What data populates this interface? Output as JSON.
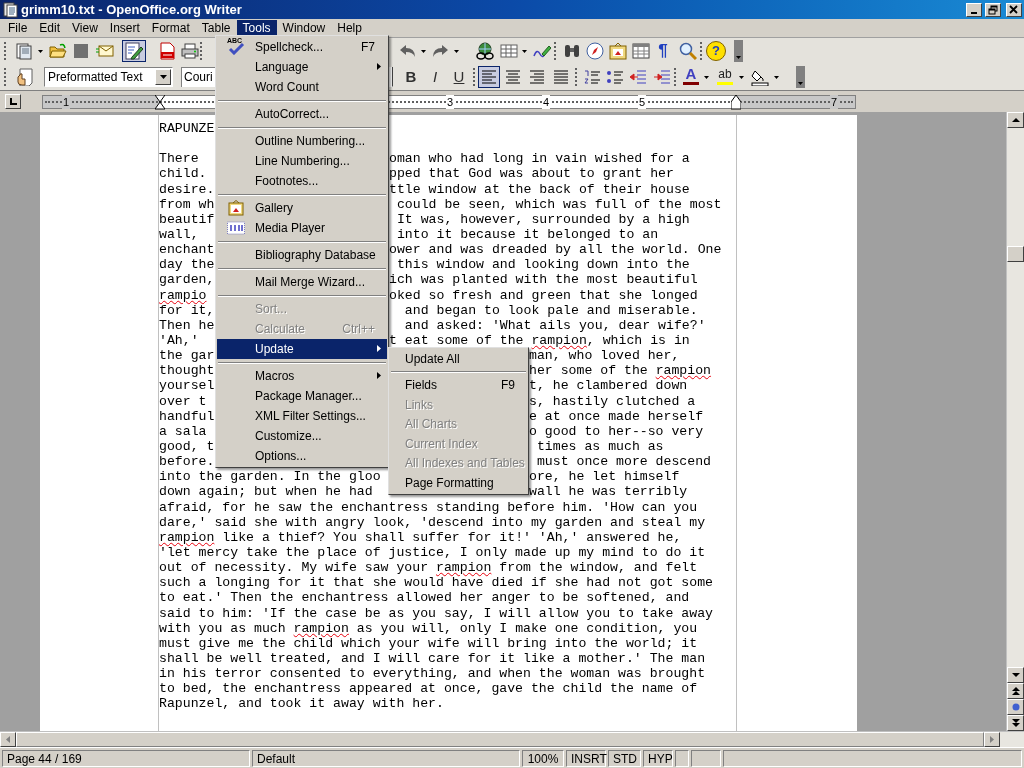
{
  "window": {
    "title": "grimm10.txt - OpenOffice.org Writer"
  },
  "menubar": [
    {
      "label": "File",
      "selected": false
    },
    {
      "label": "Edit",
      "selected": false
    },
    {
      "label": "View",
      "selected": false
    },
    {
      "label": "Insert",
      "selected": false
    },
    {
      "label": "Format",
      "selected": false
    },
    {
      "label": "Table",
      "selected": false
    },
    {
      "label": "Tools",
      "selected": true
    },
    {
      "label": "Window",
      "selected": false
    },
    {
      "label": "Help",
      "selected": false
    }
  ],
  "standard_toolbar": {
    "edit_mode_on": true,
    "pilcrow_glyph": "¶",
    "help_glyph": "?"
  },
  "formatting_toolbar": {
    "paragraph_style": "Preformatted Text",
    "font_name": "Couri",
    "format_buttons": [
      {
        "label": "B",
        "on": false
      },
      {
        "label": "I",
        "on": false
      },
      {
        "label": "U",
        "on": false
      }
    ],
    "alignment": [
      {
        "selected": true
      },
      {
        "selected": false
      },
      {
        "selected": false
      },
      {
        "selected": false
      }
    ],
    "font_color_glyph": "A",
    "highlight_glyph": "ab"
  },
  "ruler": {
    "labels": [
      "1",
      "3",
      "4",
      "5",
      "7"
    ]
  },
  "document": {
    "paragraphs": [
      {
        "lines": [
          {
            "segments": [
              {
                "kind": "left",
                "runs": [
                  {
                    "text": "RAPUNZE",
                    "misspelled": false
                  }
                ]
              }
            ]
          }
        ]
      },
      {
        "lines": [
          {
            "segments": [
              {
                "kind": "left",
                "runs": [
                  {
                    "text": "There ",
                    "misspelled": false
                  }
                ]
              },
              {
                "kind": "after_menu",
                "runs": [
                  {
                    "text": "oman who had long in vain wished for a",
                    "misspelled": false
                  }
                ]
              }
            ]
          },
          {
            "segments": [
              {
                "kind": "left",
                "runs": [
                  {
                    "text": "child.",
                    "misspelled": false
                  }
                ]
              },
              {
                "kind": "after_menu",
                "runs": [
                  {
                    "text": "pped that God was about to grant her",
                    "misspelled": false
                  }
                ]
              }
            ]
          },
          {
            "segments": [
              {
                "kind": "left",
                "runs": [
                  {
                    "text": "desire.",
                    "misspelled": false
                  }
                ]
              },
              {
                "kind": "after_menu",
                "runs": [
                  {
                    "text": "ttle window at the back of their house",
                    "misspelled": false
                  }
                ]
              }
            ]
          },
          {
            "segments": [
              {
                "kind": "left",
                "runs": [
                  {
                    "text": "from wh",
                    "misspelled": false
                  }
                ]
              },
              {
                "kind": "after_menu",
                "runs": [
                  {
                    "text": " could be seen, which was full of the most",
                    "misspelled": false
                  }
                ]
              }
            ]
          },
          {
            "segments": [
              {
                "kind": "left",
                "runs": [
                  {
                    "text": "beautif",
                    "misspelled": false
                  }
                ]
              },
              {
                "kind": "after_menu",
                "runs": [
                  {
                    "text": " It was, however, surrounded by a high",
                    "misspelled": false
                  }
                ]
              }
            ]
          },
          {
            "segments": [
              {
                "kind": "left",
                "runs": [
                  {
                    "text": "wall, ",
                    "misspelled": false
                  }
                ]
              },
              {
                "kind": "after_menu",
                "runs": [
                  {
                    "text": " into it because it belonged to an",
                    "misspelled": false
                  }
                ]
              }
            ]
          },
          {
            "segments": [
              {
                "kind": "left",
                "runs": [
                  {
                    "text": "enchant",
                    "misspelled": false
                  }
                ]
              },
              {
                "kind": "after_menu",
                "runs": [
                  {
                    "text": "ower and was dreaded by all the world. One",
                    "misspelled": false
                  }
                ]
              }
            ]
          },
          {
            "segments": [
              {
                "kind": "left",
                "runs": [
                  {
                    "text": "day the",
                    "misspelled": false
                  }
                ]
              },
              {
                "kind": "after_menu",
                "runs": [
                  {
                    "text": " this window and looking down into the",
                    "misspelled": false
                  }
                ]
              }
            ]
          },
          {
            "segments": [
              {
                "kind": "left",
                "runs": [
                  {
                    "text": "garden,",
                    "misspelled": false
                  }
                ]
              },
              {
                "kind": "after_menu",
                "runs": [
                  {
                    "text": "ich was planted with the most beautiful",
                    "misspelled": false
                  }
                ]
              }
            ]
          },
          {
            "segments": [
              {
                "kind": "left",
                "runs": [
                  {
                    "text": "rampio",
                    "misspelled": true
                  }
                ]
              },
              {
                "kind": "after_menu",
                "runs": [
                  {
                    "text": "oked so fresh and green that she longed",
                    "misspelled": false
                  }
                ]
              }
            ]
          },
          {
            "segments": [
              {
                "kind": "left",
                "runs": [
                  {
                    "text": "for it,",
                    "misspelled": false
                  }
                ]
              },
              {
                "kind": "after_menu",
                "runs": [
                  {
                    "text": "  and began to look pale and miserable.",
                    "misspelled": false
                  }
                ]
              }
            ]
          },
          {
            "segments": [
              {
                "kind": "left",
                "runs": [
                  {
                    "text": "Then he",
                    "misspelled": false
                  }
                ]
              },
              {
                "kind": "after_menu",
                "runs": [
                  {
                    "text": "  and asked: 'What ails you, dear wife?'",
                    "misspelled": false
                  }
                ]
              }
            ]
          },
          {
            "segments": [
              {
                "kind": "left",
                "runs": [
                  {
                    "text": "'Ah,' ",
                    "misspelled": false
                  }
                ]
              },
              {
                "kind": "after_menu",
                "runs": [
                  {
                    "text": "t eat some of the ",
                    "misspelled": false
                  },
                  {
                    "text": "rampion",
                    "misspelled": true
                  },
                  {
                    "text": ", which is in",
                    "misspelled": false
                  }
                ]
              }
            ]
          },
          {
            "segments": [
              {
                "kind": "left",
                "runs": [
                  {
                    "text": "the gar",
                    "misspelled": false
                  }
                ]
              },
              {
                "kind": "after_submenu",
                "runs": [
                  {
                    "text": "man, who loved her,",
                    "misspelled": false
                  }
                ]
              }
            ]
          },
          {
            "segments": [
              {
                "kind": "left",
                "runs": [
                  {
                    "text": "thought",
                    "misspelled": false
                  }
                ]
              },
              {
                "kind": "after_submenu",
                "runs": [
                  {
                    "text": "her some of the ",
                    "misspelled": false
                  },
                  {
                    "text": "rampion",
                    "misspelled": true
                  }
                ]
              }
            ]
          },
          {
            "segments": [
              {
                "kind": "left",
                "runs": [
                  {
                    "text": "yoursel",
                    "misspelled": false
                  }
                ]
              },
              {
                "kind": "after_submenu",
                "runs": [
                  {
                    "text": "t, he clambered down",
                    "misspelled": false
                  }
                ]
              }
            ]
          },
          {
            "segments": [
              {
                "kind": "left",
                "runs": [
                  {
                    "text": "over t",
                    "misspelled": false
                  }
                ]
              },
              {
                "kind": "after_submenu",
                "runs": [
                  {
                    "text": "s, hastily clutched a",
                    "misspelled": false
                  }
                ]
              }
            ]
          },
          {
            "segments": [
              {
                "kind": "left",
                "runs": [
                  {
                    "text": "handful",
                    "misspelled": false
                  }
                ]
              },
              {
                "kind": "after_submenu",
                "runs": [
                  {
                    "text": "e at once made herself",
                    "misspelled": false
                  }
                ]
              }
            ]
          },
          {
            "segments": [
              {
                "kind": "left",
                "runs": [
                  {
                    "text": "a sala",
                    "misspelled": false
                  }
                ]
              },
              {
                "kind": "after_submenu",
                "runs": [
                  {
                    "text": "o good to her--so very",
                    "misspelled": false
                  }
                ]
              }
            ]
          },
          {
            "segments": [
              {
                "kind": "left",
                "runs": [
                  {
                    "text": "good, t",
                    "misspelled": false
                  }
                ]
              },
              {
                "kind": "after_submenu",
                "runs": [
                  {
                    "text": " times as much as",
                    "misspelled": false
                  }
                ]
              }
            ]
          },
          {
            "segments": [
              {
                "kind": "left",
                "runs": [
                  {
                    "text": "before.",
                    "misspelled": false
                  }
                ]
              },
              {
                "kind": "after_submenu",
                "runs": [
                  {
                    "text": " must once more descend",
                    "misspelled": false
                  }
                ]
              }
            ]
          },
          {
            "segments": [
              {
                "kind": "left",
                "runs": [
                  {
                    "text": "into the garden. In the gloo",
                    "misspelled": false
                  }
                ]
              },
              {
                "kind": "after_submenu",
                "runs": [
                  {
                    "text": "ore, he let himself",
                    "misspelled": false
                  }
                ]
              }
            ]
          },
          {
            "segments": [
              {
                "kind": "left",
                "runs": [
                  {
                    "text": "down again; but when he had",
                    "misspelled": false
                  }
                ]
              },
              {
                "kind": "after_submenu",
                "runs": [
                  {
                    "text": "wall he was terribly",
                    "misspelled": false
                  }
                ]
              }
            ]
          },
          {
            "segments": [
              {
                "kind": "left",
                "runs": [
                  {
                    "text": "afraid, for he saw the enchantress standing before him. 'How can you",
                    "misspelled": false
                  }
                ]
              }
            ]
          },
          {
            "segments": [
              {
                "kind": "left",
                "runs": [
                  {
                    "text": "dare,' said she with angry look, 'descend into my garden and steal my",
                    "misspelled": false
                  }
                ]
              }
            ]
          },
          {
            "segments": [
              {
                "kind": "left",
                "runs": [
                  {
                    "text": "rampion",
                    "misspelled": true
                  },
                  {
                    "text": " like a thief? You shall suffer for it!' 'Ah,' answered he,",
                    "misspelled": false
                  }
                ]
              }
            ]
          },
          {
            "segments": [
              {
                "kind": "left",
                "runs": [
                  {
                    "text": "'let mercy take the place of justice, I only made up my mind to do it",
                    "misspelled": false
                  }
                ]
              }
            ]
          },
          {
            "segments": [
              {
                "kind": "left",
                "runs": [
                  {
                    "text": "out of necessity. My wife saw your ",
                    "misspelled": false
                  },
                  {
                    "text": "rampion",
                    "misspelled": true
                  },
                  {
                    "text": " from the window, and felt",
                    "misspelled": false
                  }
                ]
              }
            ]
          },
          {
            "segments": [
              {
                "kind": "left",
                "runs": [
                  {
                    "text": "such a longing for it that she would have died if she had not got some",
                    "misspelled": false
                  }
                ]
              }
            ]
          },
          {
            "segments": [
              {
                "kind": "left",
                "runs": [
                  {
                    "text": "to eat.' Then the enchantress allowed her anger to be softened, and",
                    "misspelled": false
                  }
                ]
              }
            ]
          },
          {
            "segments": [
              {
                "kind": "left",
                "runs": [
                  {
                    "text": "said to him: 'If the case be as you say, I will allow you to take away",
                    "misspelled": false
                  }
                ]
              }
            ]
          },
          {
            "segments": [
              {
                "kind": "left",
                "runs": [
                  {
                    "text": "with you as much ",
                    "misspelled": false
                  },
                  {
                    "text": "rampion",
                    "misspelled": true
                  },
                  {
                    "text": " as you will, only I make one condition, you",
                    "misspelled": false
                  }
                ]
              }
            ]
          },
          {
            "segments": [
              {
                "kind": "left",
                "runs": [
                  {
                    "text": "must give me the child which your wife will bring into the world; it",
                    "misspelled": false
                  }
                ]
              }
            ]
          },
          {
            "segments": [
              {
                "kind": "left",
                "runs": [
                  {
                    "text": "shall be well treated, and I will care for it like a mother.' The man",
                    "misspelled": false
                  }
                ]
              }
            ]
          },
          {
            "segments": [
              {
                "kind": "left",
                "runs": [
                  {
                    "text": "in his terror consented to everything, and when the woman was brought",
                    "misspelled": false
                  }
                ]
              }
            ]
          },
          {
            "segments": [
              {
                "kind": "left",
                "runs": [
                  {
                    "text": "to bed, the enchantress appeared at once, gave the child the name of",
                    "misspelled": false
                  }
                ]
              }
            ]
          },
          {
            "segments": [
              {
                "kind": "left",
                "runs": [
                  {
                    "text": "Rapunzel, and took it away with her.",
                    "misspelled": false
                  }
                ]
              }
            ]
          }
        ]
      }
    ]
  },
  "tools_menu": {
    "items": [
      {
        "kind": "item",
        "label": "Spellcheck...",
        "shortcut": "F7",
        "icon_glyph": "ABC",
        "submenu": false,
        "disabled": false,
        "selected": false
      },
      {
        "kind": "item",
        "label": "Language",
        "submenu": true,
        "disabled": false,
        "selected": false
      },
      {
        "kind": "item",
        "label": "Word Count",
        "submenu": false,
        "disabled": false,
        "selected": false
      },
      {
        "kind": "separator"
      },
      {
        "kind": "item",
        "label": "AutoCorrect...",
        "submenu": false,
        "disabled": false,
        "selected": false
      },
      {
        "kind": "separator"
      },
      {
        "kind": "item",
        "label": "Outline Numbering...",
        "submenu": false,
        "disabled": false,
        "selected": false
      },
      {
        "kind": "item",
        "label": "Line Numbering...",
        "submenu": false,
        "disabled": false,
        "selected": false
      },
      {
        "kind": "item",
        "label": "Footnotes...",
        "submenu": false,
        "disabled": false,
        "selected": false
      },
      {
        "kind": "separator"
      },
      {
        "kind": "item",
        "label": "Gallery",
        "submenu": false,
        "disabled": false,
        "selected": false
      },
      {
        "kind": "item",
        "label": "Media Player",
        "submenu": false,
        "disabled": false,
        "selected": false
      },
      {
        "kind": "separator"
      },
      {
        "kind": "item",
        "label": "Bibliography Database",
        "submenu": false,
        "disabled": false,
        "selected": false
      },
      {
        "kind": "separator"
      },
      {
        "kind": "item",
        "label": "Mail Merge Wizard...",
        "submenu": false,
        "disabled": false,
        "selected": false
      },
      {
        "kind": "separator"
      },
      {
        "kind": "item",
        "label": "Sort...",
        "submenu": false,
        "disabled": true,
        "selected": false
      },
      {
        "kind": "item",
        "label": "Calculate",
        "shortcut": "Ctrl++",
        "submenu": false,
        "disabled": true,
        "selected": false
      },
      {
        "kind": "item",
        "label": "Update",
        "submenu": true,
        "disabled": false,
        "selected": true
      },
      {
        "kind": "separator"
      },
      {
        "kind": "item",
        "label": "Macros",
        "submenu": true,
        "disabled": false,
        "selected": false
      },
      {
        "kind": "item",
        "label": "Package Manager...",
        "submenu": false,
        "disabled": false,
        "selected": false
      },
      {
        "kind": "item",
        "label": "XML Filter Settings...",
        "submenu": false,
        "disabled": false,
        "selected": false
      },
      {
        "kind": "item",
        "label": "Customize...",
        "submenu": false,
        "disabled": false,
        "selected": false
      },
      {
        "kind": "item",
        "label": "Options...",
        "submenu": false,
        "disabled": false,
        "selected": false
      }
    ]
  },
  "update_submenu": {
    "items": [
      {
        "kind": "item",
        "label": "Update All",
        "submenu": false,
        "disabled": false,
        "selected": false
      },
      {
        "kind": "separator"
      },
      {
        "kind": "item",
        "label": "Fields",
        "shortcut": "F9",
        "submenu": false,
        "disabled": false,
        "selected": false
      },
      {
        "kind": "item",
        "label": "Links",
        "submenu": false,
        "disabled": true,
        "selected": false
      },
      {
        "kind": "item",
        "label": "All Charts",
        "submenu": false,
        "disabled": true,
        "selected": false
      },
      {
        "kind": "item",
        "label": "Current Index",
        "submenu": false,
        "disabled": true,
        "selected": false
      },
      {
        "kind": "item",
        "label": "All Indexes and Tables",
        "submenu": false,
        "disabled": true,
        "selected": false
      },
      {
        "kind": "item",
        "label": "Page Formatting",
        "submenu": false,
        "disabled": false,
        "selected": false
      }
    ]
  },
  "status_bar": [
    "Page 44 / 169",
    "Default",
    "100%",
    "INSRT",
    "STD",
    "HYP"
  ]
}
